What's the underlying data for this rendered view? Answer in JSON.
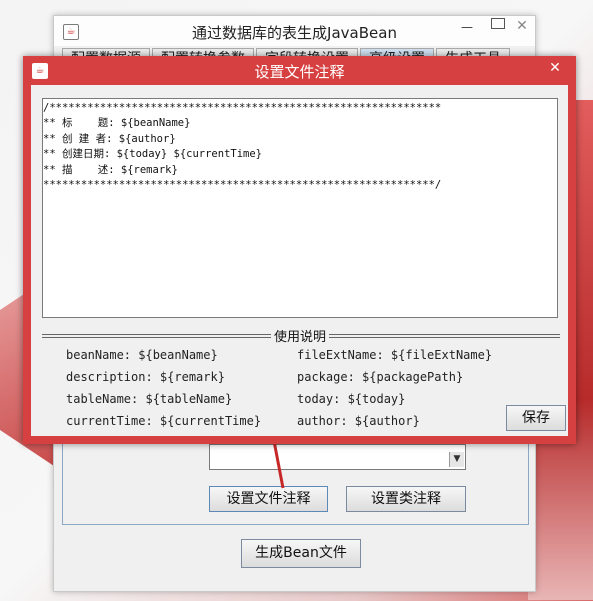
{
  "main_window": {
    "title": "通过数据库的表生成JavaBean",
    "min_label": "—",
    "close_label": "✕",
    "tabs": [
      "配置数据源",
      "配置转换参数",
      "字段转换设置",
      "高级设置",
      "生成工具"
    ],
    "active_tab": 3,
    "set_file_comment_button": "设置文件注释",
    "set_class_comment_button": "设置类注释",
    "generate_button": "生成Bean文件"
  },
  "dialog": {
    "title": "设置文件注释",
    "close_label": "✕",
    "template_text": "/**************************************************************\n** 标    题: ${beanName}\n** 创 建 者: ${author}\n** 创建日期: ${today} ${currentTime}\n** 描    述: ${remark}\n**************************************************************/",
    "usage_title": "使用说明",
    "usage_left": [
      "beanName: ${beanName}",
      "description: ${remark}",
      "tableName: ${tableName}",
      "currentTime: ${currentTime}"
    ],
    "usage_right": [
      "fileExtName: ${fileExtName}",
      "package: ${packagePath}",
      "today: ${today}",
      "author: ${author}"
    ],
    "save_button": "保存"
  },
  "colors": {
    "dialog_frame": "#d64040",
    "arrow": "#c62828"
  }
}
